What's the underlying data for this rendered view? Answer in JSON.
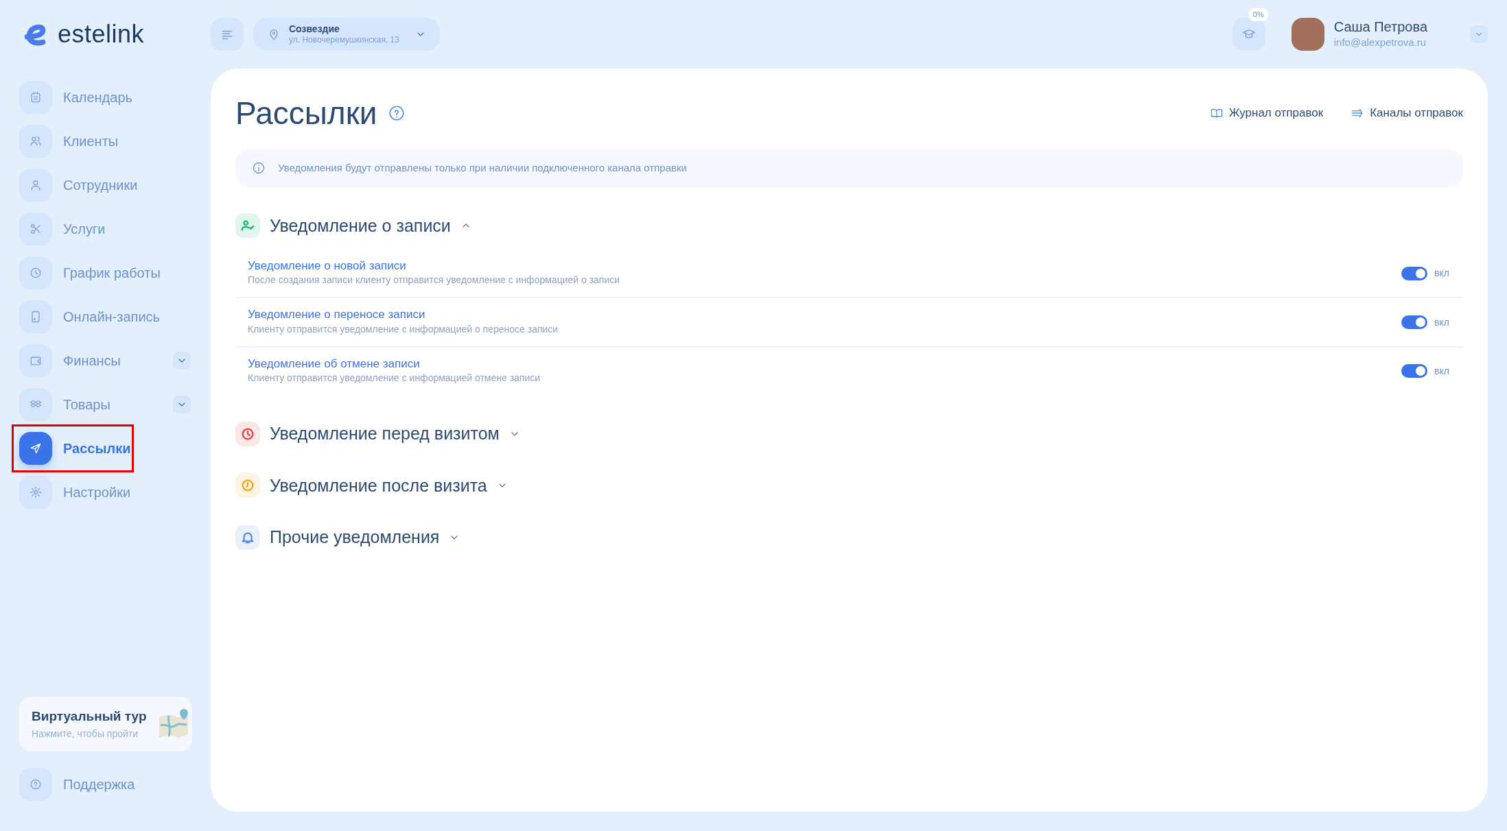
{
  "logo": {
    "text": "estelink"
  },
  "location": {
    "name": "Созвездие",
    "address": "ул. Новочеремушкинская, 13"
  },
  "progress": {
    "label": "0%"
  },
  "user": {
    "name": "Саша Петрова",
    "email": "info@alexpetrova.ru"
  },
  "sidebar": {
    "items": [
      {
        "label": "Календарь",
        "kind": "link",
        "selected": false
      },
      {
        "label": "Клиенты",
        "kind": "link",
        "selected": false
      },
      {
        "label": "Сотрудники",
        "kind": "link",
        "selected": false
      },
      {
        "label": "Услуги",
        "kind": "link",
        "selected": false
      },
      {
        "label": "График работы",
        "kind": "link",
        "selected": false
      },
      {
        "label": "Онлайн-запись",
        "kind": "link",
        "selected": false
      },
      {
        "label": "Финансы",
        "kind": "group",
        "selected": false
      },
      {
        "label": "Товары",
        "kind": "group",
        "selected": false
      },
      {
        "label": "Рассылки",
        "kind": "link",
        "selected": true,
        "highlighted": true
      },
      {
        "label": "Настройки",
        "kind": "link",
        "selected": false
      }
    ],
    "tour": {
      "title": "Виртуальный тур",
      "subtitle": "Нажмите, чтобы пройти"
    },
    "support": {
      "label": "Поддержка"
    }
  },
  "page": {
    "title": "Рассылки",
    "actions": [
      "Журнал отправок",
      "Каналы отправок"
    ],
    "notice": "Уведомления будут отправлены только при наличии подключенного канала отправки",
    "sections": [
      {
        "title": "Уведомление о записи",
        "color": "#22b573",
        "expanded": true,
        "rows": [
          {
            "title": "Уведомление о новой записи",
            "description": "После создания записи клиенту отправится уведомление с информацией о записи",
            "on": true,
            "state_label": "вкл"
          },
          {
            "title": "Уведомление о переносе записи",
            "description": "Клиенту отправится уведомление с информацией о переносе записи",
            "on": true,
            "state_label": "вкл"
          },
          {
            "title": "Уведомление об отмене записи",
            "description": "Клиенту отправится уведомление с информацией отмене записи",
            "on": true,
            "state_label": "вкл"
          }
        ]
      },
      {
        "title": "Уведомление перед визитом",
        "color": "#e5484d",
        "expanded": false
      },
      {
        "title": "Уведомление после визита",
        "color": "#f0a818",
        "expanded": false
      },
      {
        "title": "Прочие уведомления",
        "color": "#5b8fe0",
        "expanded": false
      }
    ]
  }
}
